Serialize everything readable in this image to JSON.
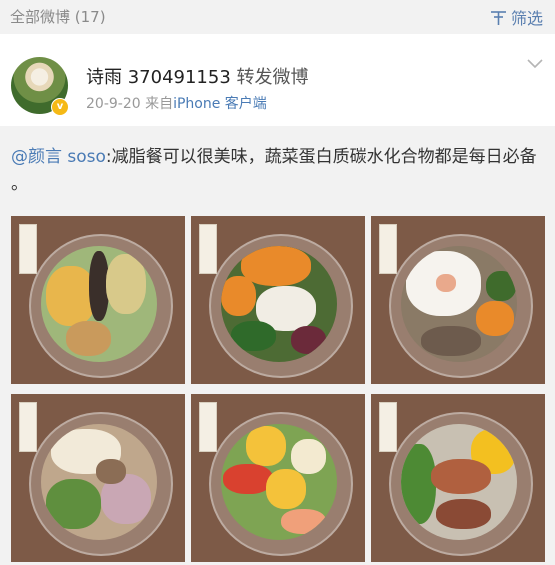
{
  "topbar": {
    "title": "全部微博 (17)",
    "filter_label": "筛选"
  },
  "post": {
    "username": "诗雨 370491153",
    "action": "转发微博",
    "date": "20-9-20",
    "source_prefix": "来自",
    "device": "iPhone 客户端"
  },
  "repost": {
    "mention": "@颜言 soso",
    "text": ":减脂餐可以很美味，蔬菜蛋白质碳水化合物都是每日必备 。"
  },
  "photos": [
    {
      "name": "sandwich-bowl"
    },
    {
      "name": "pumpkin-chicken-bowl"
    },
    {
      "name": "egg-pumpkin-bowl"
    },
    {
      "name": "pasta-cucumber-bowl"
    },
    {
      "name": "egg-shrimp-salad-bowl"
    },
    {
      "name": "salmon-beans-bowl"
    }
  ]
}
